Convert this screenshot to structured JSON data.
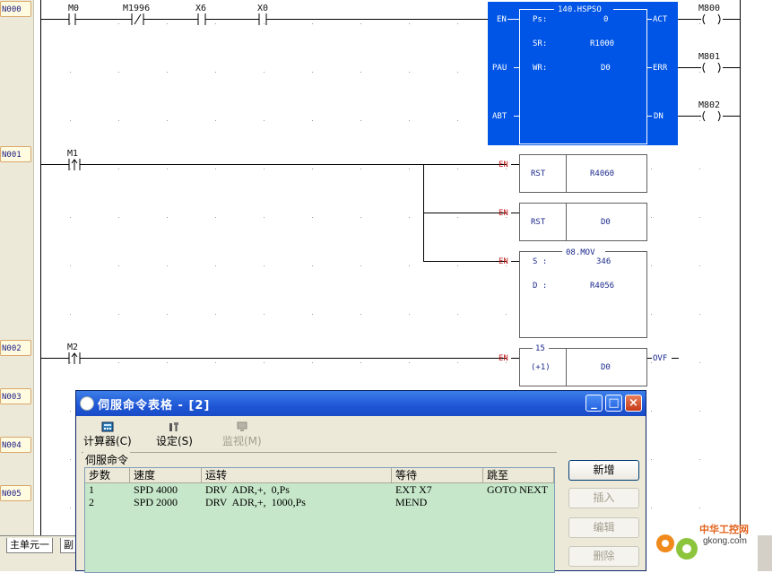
{
  "networks": [
    "N000",
    "N001",
    "N002",
    "N003",
    "N004",
    "N005"
  ],
  "contacts": {
    "n0": [
      "M0",
      "M1996",
      "X6",
      "X0"
    ],
    "n1": "M1",
    "n2": "M2"
  },
  "coils": [
    "M800",
    "M801",
    "M802"
  ],
  "hspso": {
    "title": "140.HSPSO",
    "inputs": [
      "EN",
      "PAU",
      "ABT"
    ],
    "outputs": [
      "ACT",
      "ERR",
      "DN"
    ],
    "params": [
      {
        "name": "Ps:",
        "value": "0"
      },
      {
        "name": "SR:",
        "value": "R1000"
      },
      {
        "name": "WR:",
        "value": "D0"
      }
    ]
  },
  "rst1": {
    "en": "EN",
    "op": "RST",
    "arg": "R4060"
  },
  "rst2": {
    "en": "EN",
    "op": "RST",
    "arg": "D0"
  },
  "mov": {
    "en": "EN",
    "title": "08.MOV",
    "s_label": "S :",
    "s_val": "346",
    "d_label": "D :",
    "d_val": "R4056"
  },
  "inc": {
    "en": "EN",
    "title": "15",
    "op": "(+1)",
    "arg": "D0",
    "out": "OVF"
  },
  "tabs": [
    "主单元一",
    "副"
  ],
  "dialog": {
    "title": "伺服命令表格 - [2]",
    "toolbar": [
      "计算器(C)",
      "设定(S)",
      "监视(M)"
    ],
    "group_title": "伺服命令",
    "columns": [
      "步数",
      "速度",
      "运转",
      "等待",
      "跳至"
    ],
    "rows": [
      {
        "step": "1",
        "speed": "SPD 4000",
        "run": "DRV  ADR,+,  0,Ps",
        "wait": "EXT X7",
        "jump": "GOTO NEXT"
      },
      {
        "step": "2",
        "speed": "SPD 2000",
        "run": "DRV  ADR,+,  1000,Ps",
        "wait": "MEND",
        "jump": ""
      }
    ],
    "buttons": [
      "新增",
      "插入",
      "编辑",
      "删除"
    ]
  },
  "watermark": {
    "line1": "中华工控网",
    "line2": "gkong.com"
  },
  "colors": {
    "fb_blue": "#0055e6",
    "en_red": "#c01818",
    "table_green": "#c6e7c9"
  }
}
